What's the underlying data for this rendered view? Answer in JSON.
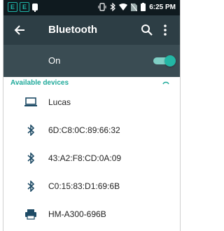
{
  "status_bar": {
    "time": "6:25 PM",
    "icons": [
      "app-notification-icon",
      "app-notification-icon",
      "android-debug-icon",
      "vibrate-icon",
      "bluetooth-icon",
      "wifi-icon",
      "no-sim-icon",
      "battery-icon"
    ]
  },
  "app_bar": {
    "title": "Bluetooth",
    "icons": [
      "back-arrow-icon",
      "search-icon",
      "overflow-menu-icon"
    ]
  },
  "toggle": {
    "label": "On",
    "state": true,
    "accent": "#23b7a5"
  },
  "section": {
    "header": "Available devices"
  },
  "devices": [
    {
      "name": "Lucas",
      "icon": "laptop-icon"
    },
    {
      "name": "6D:C8:0C:89:66:32",
      "icon": "bluetooth-icon"
    },
    {
      "name": "43:A2:F8:CD:0A:09",
      "icon": "bluetooth-icon"
    },
    {
      "name": "C0:15:83:D1:69:6B",
      "icon": "bluetooth-icon"
    },
    {
      "name": "HM-A300-696B",
      "icon": "printer-icon"
    }
  ],
  "colors": {
    "app_bar": "#2d3e45",
    "switch_row": "#3a4c53",
    "accent": "#1ea99a",
    "status_bar": "#0f1a1f"
  }
}
